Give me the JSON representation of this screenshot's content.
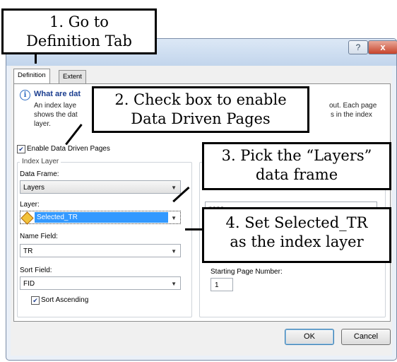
{
  "window": {
    "help_glyph": "?",
    "close_glyph": "x",
    "tabs": [
      {
        "label": "Definition",
        "active": true
      },
      {
        "label": "Extent",
        "active": false
      }
    ],
    "info": {
      "title": "What are dat",
      "line1": "An index laye",
      "line2": "shows the dat",
      "line3": "layer.",
      "line1_right": "out.  Each page",
      "line2_right": "s in the index"
    },
    "enable_checkbox": {
      "checked": true,
      "label": "Enable Data Driven Pages"
    },
    "index_layer": {
      "group_title": "Index Layer",
      "data_frame_label": "Data Frame:",
      "data_frame_value": "Layers",
      "layer_label": "Layer:",
      "layer_value": "Selected_TR",
      "name_field_label": "Name Field:",
      "name_field_value": "TR",
      "sort_field_label": "Sort Field:",
      "sort_field_value": "FID",
      "sort_ascending_label": "Sort Ascending",
      "sort_ascending_checked": true
    },
    "right_panel": {
      "combo_value": "none",
      "starting_page_label": "Starting Page Number:",
      "starting_page_value": "1"
    },
    "buttons": {
      "ok": "OK",
      "cancel": "Cancel"
    }
  },
  "callouts": {
    "step1": [
      "1. Go to",
      "Definition Tab"
    ],
    "step2": [
      "2. Check box to enable",
      "Data Driven Pages"
    ],
    "step3": [
      "3. Pick the “Layers”",
      "data frame"
    ],
    "step4": [
      "4. Set Selected_TR",
      "as the index layer"
    ]
  }
}
